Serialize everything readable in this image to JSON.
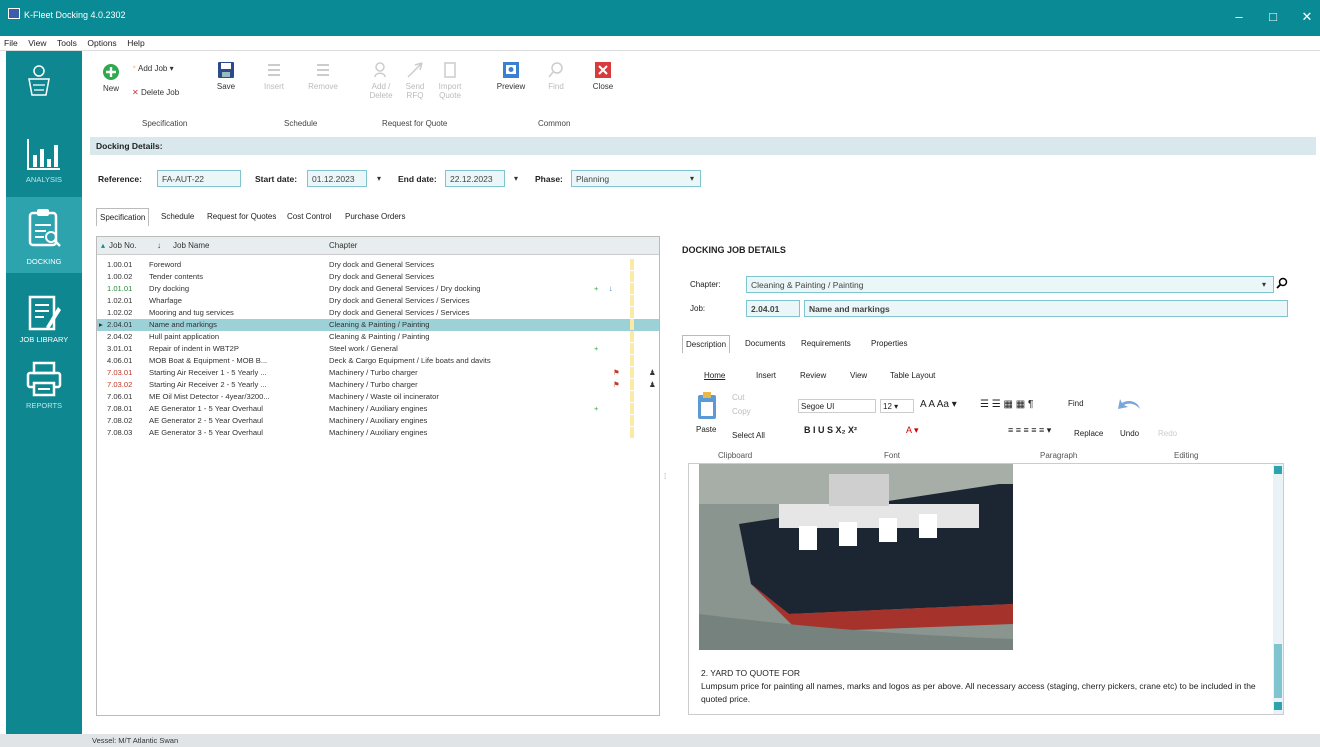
{
  "window": {
    "title": "K-Fleet Docking 4.0.2302",
    "minimize": "–",
    "maximize": "□",
    "close": "✕"
  },
  "menu": [
    "File",
    "View",
    "Tools",
    "Options",
    "Help"
  ],
  "sidebar": [
    {
      "label": "",
      "icon": "crest-logo-icon"
    },
    {
      "label": "ANALYSIS",
      "icon": "bar-chart-icon"
    },
    {
      "label": "DOCKING",
      "icon": "docking-document-icon"
    },
    {
      "label": "JOB LIBRARY",
      "icon": "job-library-icon"
    },
    {
      "label": "REPORTS",
      "icon": "printer-icon"
    }
  ],
  "ribbon": {
    "new": "New",
    "add_job": "Add Job",
    "delete_job": "Delete Job",
    "save": "Save",
    "insert": "Insert",
    "remove": "Remove",
    "rfq1": "Add / Delete",
    "rfq2": "Send RFQ",
    "rfq3": "Import Quote",
    "preview": "Preview",
    "find": "Find",
    "close": "Close",
    "groups": {
      "specification": "Specification",
      "schedule": "Schedule",
      "rfq": "Request for Quote",
      "common": "Common"
    }
  },
  "docking_details": {
    "header": "Docking Details:",
    "reference_label": "Reference:",
    "reference_value": "FA-AUT-22",
    "start_label": "Start date:",
    "start_value": "01.12.2023",
    "end_label": "End date:",
    "end_value": "22.12.2023",
    "phase_label": "Phase:",
    "phase_value": "Planning"
  },
  "tabs": [
    "Specification",
    "Schedule",
    "Request for Quotes",
    "Cost Control",
    "Purchase Orders"
  ],
  "grid": {
    "columns": [
      "Job No.",
      "Job Name",
      "Chapter"
    ],
    "rows": [
      {
        "no": "1.00.01",
        "name": "Foreword",
        "chapter": "Dry dock and General Services"
      },
      {
        "no": "1.00.02",
        "name": "Tender contents",
        "chapter": "Dry dock and General Services"
      },
      {
        "no": "1.01.01",
        "name": "Dry docking",
        "chapter": "Dry dock and General Services / Dry docking"
      },
      {
        "no": "1.02.01",
        "name": "Wharfage",
        "chapter": "Dry dock and General Services / Services"
      },
      {
        "no": "1.02.02",
        "name": "Mooring and tug services",
        "chapter": "Dry dock and General Services / Services"
      },
      {
        "no": "2.04.01",
        "name": "Name and markings",
        "chapter": "Cleaning & Painting / Painting"
      },
      {
        "no": "2.04.02",
        "name": "Hull paint application",
        "chapter": "Cleaning & Painting / Painting"
      },
      {
        "no": "3.01.01",
        "name": "Repair of indent in WBT2P",
        "chapter": "Steel work / General"
      },
      {
        "no": "4.06.01",
        "name": "MOB Boat & Equipment - MOB B...",
        "chapter": "Deck & Cargo Equipment / Life boats and davits"
      },
      {
        "no": "7.03.01",
        "name": "Starting Air Receiver 1 - 5 Yearly ...",
        "chapter": "Machinery / Turbo charger"
      },
      {
        "no": "7.03.02",
        "name": "Starting Air Receiver 2 - 5 Yearly ...",
        "chapter": "Machinery / Turbo charger"
      },
      {
        "no": "7.06.01",
        "name": "ME Oil Mist Detector - 4year/3200...",
        "chapter": "Machinery / Waste oil incinerator"
      },
      {
        "no": "7.08.01",
        "name": "AE Generator 1 - 5 Year Overhaul",
        "chapter": "Machinery / Auxiliary engines"
      },
      {
        "no": "7.08.02",
        "name": "AE Generator 2 - 5 Year Overhaul",
        "chapter": "Machinery / Auxiliary engines"
      },
      {
        "no": "7.08.03",
        "name": "AE Generator 3 - 5 Year Overhaul",
        "chapter": "Machinery / Auxiliary engines"
      }
    ]
  },
  "job_details": {
    "title": "DOCKING JOB DETAILS",
    "chapter_label": "Chapter:",
    "chapter_value": "Cleaning & Painting / Painting",
    "job_label": "Job:",
    "job_no": "2.04.01",
    "job_name": "Name and markings",
    "tabs": [
      "Description",
      "Documents",
      "Requirements",
      "Properties"
    ],
    "editor_tabs": [
      "Home",
      "Insert",
      "Review",
      "View",
      "Table Layout"
    ],
    "paste": "Paste",
    "cut": "Cut",
    "copy": "Copy",
    "select_all": "Select All",
    "font_name": "Segoe UI",
    "font_size": "12",
    "find": "Find",
    "replace": "Replace",
    "undo": "Undo",
    "redo": "Redo",
    "groups": [
      "Clipboard",
      "Font",
      "Paragraph",
      "Editing"
    ],
    "text_heading": "2. YARD TO QUOTE FOR",
    "text_body": "Lumpsum price for painting all names, marks and logos as per above. All necessary access (staging, cherry pickers, crane etc) to be included in the quoted price."
  },
  "status": "Vessel: M/T Atlantic Swan"
}
